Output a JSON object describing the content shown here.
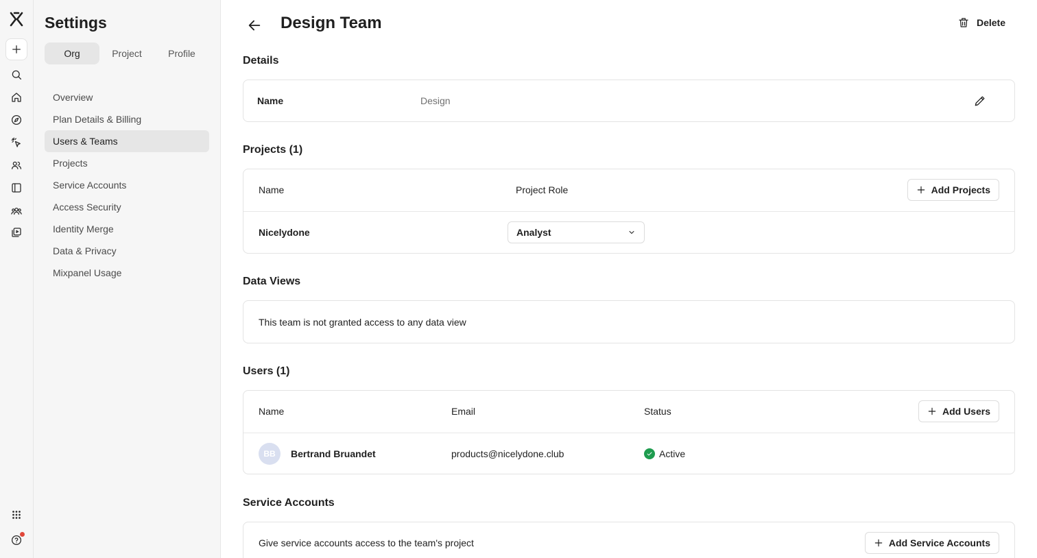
{
  "sidebar": {
    "title": "Settings",
    "tabs": [
      "Org",
      "Project",
      "Profile"
    ],
    "active_tab": "Org",
    "items": [
      {
        "label": "Overview"
      },
      {
        "label": "Plan Details & Billing"
      },
      {
        "label": "Users & Teams"
      },
      {
        "label": "Projects"
      },
      {
        "label": "Service Accounts"
      },
      {
        "label": "Access Security"
      },
      {
        "label": "Identity Merge"
      },
      {
        "label": "Data & Privacy"
      },
      {
        "label": "Mixpanel Usage"
      }
    ],
    "active_item": "Users & Teams"
  },
  "rail": {
    "icons": [
      "mixpanel-logo-icon",
      "plus-icon",
      "search-icon",
      "home-icon",
      "compass-icon",
      "cursor-click-icon",
      "users-icon",
      "sidebar-panel-icon",
      "group-icon",
      "play-library-icon",
      "apps-grid-icon",
      "help-icon"
    ],
    "notification_color": "#e0473a"
  },
  "header": {
    "title": "Design Team",
    "delete_label": "Delete"
  },
  "details": {
    "heading": "Details",
    "name_label": "Name",
    "name_value": "Design"
  },
  "projects": {
    "heading": "Projects (1)",
    "col_name": "Name",
    "col_role": "Project Role",
    "add_label": "Add Projects",
    "rows": [
      {
        "name": "Nicelydone",
        "role": "Analyst"
      }
    ]
  },
  "data_views": {
    "heading": "Data Views",
    "empty_text": "This team is not granted access to any data view"
  },
  "users": {
    "heading": "Users (1)",
    "col_name": "Name",
    "col_email": "Email",
    "col_status": "Status",
    "add_label": "Add Users",
    "rows": [
      {
        "initials": "BB",
        "name": "Bertrand Bruandet",
        "email": "products@nicelydone.club",
        "status": "Active"
      }
    ],
    "status_color": "#1e9c4f"
  },
  "service_accounts": {
    "heading": "Service Accounts",
    "text": "Give service accounts access to the team's project",
    "add_label": "Add Service Accounts"
  }
}
